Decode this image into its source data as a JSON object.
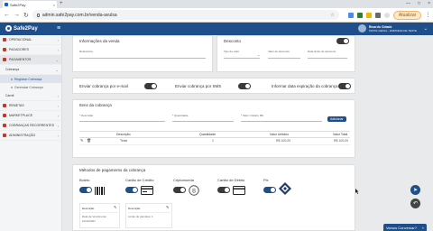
{
  "browser": {
    "tab_title": "Safe2Pay",
    "tab_close": "×",
    "new_tab": "+",
    "url": "admin.safe2pay.com.br/venda-avulsa",
    "update_label": "Atualizar",
    "window_controls": [
      "—",
      "□",
      "×"
    ]
  },
  "header": {
    "brand": "Safe2Pay",
    "user_name": "Ricardo Cidade",
    "user_sub": "TESTE GERAL - EMPRESA DE TESTE"
  },
  "sidebar": {
    "items": [
      {
        "label": "OPERACIONAL",
        "icon": "grid-icon"
      },
      {
        "label": "PAGADORES",
        "icon": "user-icon"
      },
      {
        "label": "PAGAMENTOS",
        "icon": "card-icon"
      },
      {
        "label": "Cobrança",
        "icon": "money-icon"
      }
    ],
    "subitems": [
      "Registrar Cobrança",
      "Gerenciar Cobrança"
    ],
    "items2": [
      {
        "label": "Carnê",
        "icon": "book-icon"
      },
      {
        "label": "REMETAS",
        "icon": "send-icon"
      },
      {
        "label": "MARKETPLACE",
        "icon": "store-icon"
      },
      {
        "label": "COBRANÇAS RECORRENTES",
        "icon": "repeat-icon"
      },
      {
        "label": "ADMINISTRAÇÃO",
        "icon": "gear-icon"
      }
    ]
  },
  "sale": {
    "title": "Informações da venda",
    "ref_label": "Referência",
    "discount_label": "Desconto",
    "discount_type_label": "Tipo de valor",
    "discount_value_label": "Valor do desconto",
    "discount_date_label": "Data limite do desconto"
  },
  "options": {
    "email": "Enviar cobrança por e-mail",
    "sms": "Enviar cobrança por SMS",
    "expiry": "Informar data expiração da cobrança"
  },
  "items": {
    "title": "Itens da cobrança",
    "desc_label": "* Descrição",
    "qty_label": "* Quantidade",
    "unit_label": "* Valor Unitário R$",
    "add_label": "Adicionar",
    "headers": [
      "Descrição",
      "Quantidade",
      "Valor Unitário",
      "Valor Total"
    ],
    "row": {
      "desc": "Teste",
      "qty": "1",
      "unit": "R$ 100,00",
      "total": "R$ 100,00"
    }
  },
  "payment": {
    "title": "Métodos de pagamento da cobrança",
    "methods": [
      "Boleto",
      "Cartão de Crédito",
      "Criptomoeda",
      "Cartão de Débito",
      "Pix"
    ],
    "boleto_desc_label": "Descrição",
    "boleto_due": "Data de Vencimento",
    "boleto_due_value": "10/11/2021",
    "credit_desc_label": "Descrição",
    "credit_installments": "Limite de parcelas: 1"
  },
  "chat": {
    "label": "Vamos Conversar?"
  }
}
